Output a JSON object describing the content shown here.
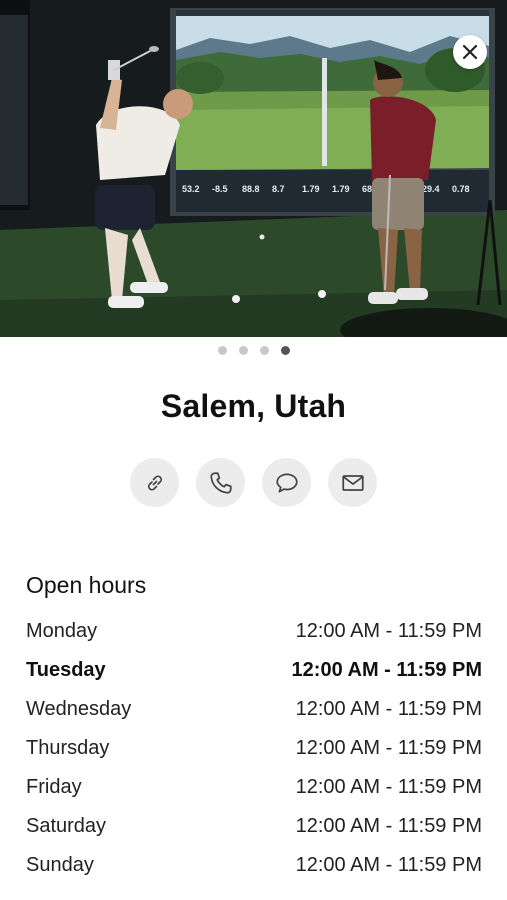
{
  "hero": {
    "alt": "Two men in an indoor golf simulator bay; one mid-swing in front of a projected golf course screen",
    "simulator_stats": [
      "53.2",
      "-8.5",
      "88.8",
      "8.7",
      "1.79",
      "1.79",
      "68.5",
      "-5.0",
      "29.4",
      "0.78"
    ],
    "slide_count": 4,
    "active_slide": 4
  },
  "close_button": {
    "icon": "close-icon"
  },
  "location": {
    "title": "Salem, Utah"
  },
  "actions": [
    {
      "name": "link-button",
      "icon": "link-icon"
    },
    {
      "name": "phone-button",
      "icon": "phone-icon"
    },
    {
      "name": "message-button",
      "icon": "chat-bubble-icon"
    },
    {
      "name": "email-button",
      "icon": "envelope-icon"
    }
  ],
  "hours": {
    "heading": "Open hours",
    "days": [
      {
        "day": "Monday",
        "time": "12:00 AM - 11:59 PM",
        "current": false
      },
      {
        "day": "Tuesday",
        "time": "12:00 AM - 11:59 PM",
        "current": true
      },
      {
        "day": "Wednesday",
        "time": "12:00 AM - 11:59 PM",
        "current": false
      },
      {
        "day": "Thursday",
        "time": "12:00 AM - 11:59 PM",
        "current": false
      },
      {
        "day": "Friday",
        "time": "12:00 AM - 11:59 PM",
        "current": false
      },
      {
        "day": "Saturday",
        "time": "12:00 AM - 11:59 PM",
        "current": false
      },
      {
        "day": "Sunday",
        "time": "12:00 AM - 11:59 PM",
        "current": false
      }
    ]
  }
}
